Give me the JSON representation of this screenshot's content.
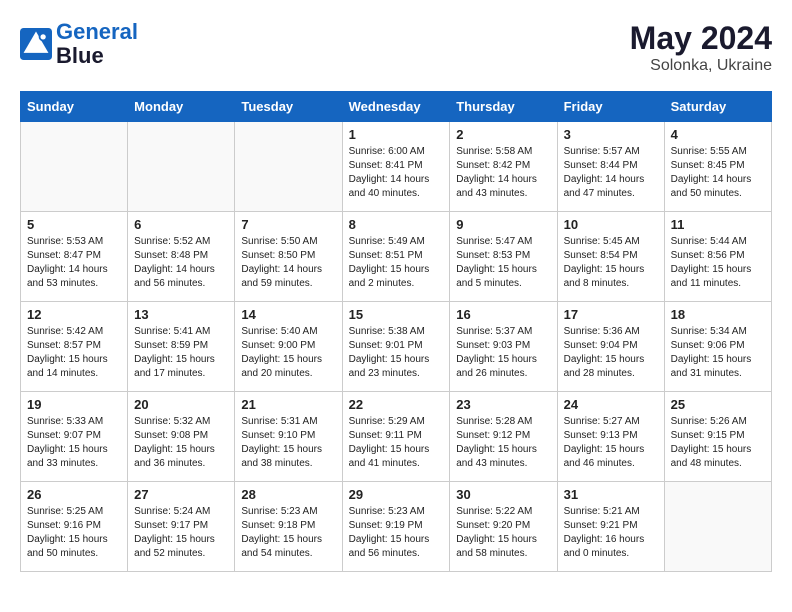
{
  "header": {
    "logo_line1": "General",
    "logo_line2": "Blue",
    "month_year": "May 2024",
    "location": "Solonka, Ukraine"
  },
  "days_of_week": [
    "Sunday",
    "Monday",
    "Tuesday",
    "Wednesday",
    "Thursday",
    "Friday",
    "Saturday"
  ],
  "weeks": [
    [
      {
        "day": "",
        "info": ""
      },
      {
        "day": "",
        "info": ""
      },
      {
        "day": "",
        "info": ""
      },
      {
        "day": "1",
        "info": "Sunrise: 6:00 AM\nSunset: 8:41 PM\nDaylight: 14 hours\nand 40 minutes."
      },
      {
        "day": "2",
        "info": "Sunrise: 5:58 AM\nSunset: 8:42 PM\nDaylight: 14 hours\nand 43 minutes."
      },
      {
        "day": "3",
        "info": "Sunrise: 5:57 AM\nSunset: 8:44 PM\nDaylight: 14 hours\nand 47 minutes."
      },
      {
        "day": "4",
        "info": "Sunrise: 5:55 AM\nSunset: 8:45 PM\nDaylight: 14 hours\nand 50 minutes."
      }
    ],
    [
      {
        "day": "5",
        "info": "Sunrise: 5:53 AM\nSunset: 8:47 PM\nDaylight: 14 hours\nand 53 minutes."
      },
      {
        "day": "6",
        "info": "Sunrise: 5:52 AM\nSunset: 8:48 PM\nDaylight: 14 hours\nand 56 minutes."
      },
      {
        "day": "7",
        "info": "Sunrise: 5:50 AM\nSunset: 8:50 PM\nDaylight: 14 hours\nand 59 minutes."
      },
      {
        "day": "8",
        "info": "Sunrise: 5:49 AM\nSunset: 8:51 PM\nDaylight: 15 hours\nand 2 minutes."
      },
      {
        "day": "9",
        "info": "Sunrise: 5:47 AM\nSunset: 8:53 PM\nDaylight: 15 hours\nand 5 minutes."
      },
      {
        "day": "10",
        "info": "Sunrise: 5:45 AM\nSunset: 8:54 PM\nDaylight: 15 hours\nand 8 minutes."
      },
      {
        "day": "11",
        "info": "Sunrise: 5:44 AM\nSunset: 8:56 PM\nDaylight: 15 hours\nand 11 minutes."
      }
    ],
    [
      {
        "day": "12",
        "info": "Sunrise: 5:42 AM\nSunset: 8:57 PM\nDaylight: 15 hours\nand 14 minutes."
      },
      {
        "day": "13",
        "info": "Sunrise: 5:41 AM\nSunset: 8:59 PM\nDaylight: 15 hours\nand 17 minutes."
      },
      {
        "day": "14",
        "info": "Sunrise: 5:40 AM\nSunset: 9:00 PM\nDaylight: 15 hours\nand 20 minutes."
      },
      {
        "day": "15",
        "info": "Sunrise: 5:38 AM\nSunset: 9:01 PM\nDaylight: 15 hours\nand 23 minutes."
      },
      {
        "day": "16",
        "info": "Sunrise: 5:37 AM\nSunset: 9:03 PM\nDaylight: 15 hours\nand 26 minutes."
      },
      {
        "day": "17",
        "info": "Sunrise: 5:36 AM\nSunset: 9:04 PM\nDaylight: 15 hours\nand 28 minutes."
      },
      {
        "day": "18",
        "info": "Sunrise: 5:34 AM\nSunset: 9:06 PM\nDaylight: 15 hours\nand 31 minutes."
      }
    ],
    [
      {
        "day": "19",
        "info": "Sunrise: 5:33 AM\nSunset: 9:07 PM\nDaylight: 15 hours\nand 33 minutes."
      },
      {
        "day": "20",
        "info": "Sunrise: 5:32 AM\nSunset: 9:08 PM\nDaylight: 15 hours\nand 36 minutes."
      },
      {
        "day": "21",
        "info": "Sunrise: 5:31 AM\nSunset: 9:10 PM\nDaylight: 15 hours\nand 38 minutes."
      },
      {
        "day": "22",
        "info": "Sunrise: 5:29 AM\nSunset: 9:11 PM\nDaylight: 15 hours\nand 41 minutes."
      },
      {
        "day": "23",
        "info": "Sunrise: 5:28 AM\nSunset: 9:12 PM\nDaylight: 15 hours\nand 43 minutes."
      },
      {
        "day": "24",
        "info": "Sunrise: 5:27 AM\nSunset: 9:13 PM\nDaylight: 15 hours\nand 46 minutes."
      },
      {
        "day": "25",
        "info": "Sunrise: 5:26 AM\nSunset: 9:15 PM\nDaylight: 15 hours\nand 48 minutes."
      }
    ],
    [
      {
        "day": "26",
        "info": "Sunrise: 5:25 AM\nSunset: 9:16 PM\nDaylight: 15 hours\nand 50 minutes."
      },
      {
        "day": "27",
        "info": "Sunrise: 5:24 AM\nSunset: 9:17 PM\nDaylight: 15 hours\nand 52 minutes."
      },
      {
        "day": "28",
        "info": "Sunrise: 5:23 AM\nSunset: 9:18 PM\nDaylight: 15 hours\nand 54 minutes."
      },
      {
        "day": "29",
        "info": "Sunrise: 5:23 AM\nSunset: 9:19 PM\nDaylight: 15 hours\nand 56 minutes."
      },
      {
        "day": "30",
        "info": "Sunrise: 5:22 AM\nSunset: 9:20 PM\nDaylight: 15 hours\nand 58 minutes."
      },
      {
        "day": "31",
        "info": "Sunrise: 5:21 AM\nSunset: 9:21 PM\nDaylight: 16 hours\nand 0 minutes."
      },
      {
        "day": "",
        "info": ""
      }
    ]
  ]
}
